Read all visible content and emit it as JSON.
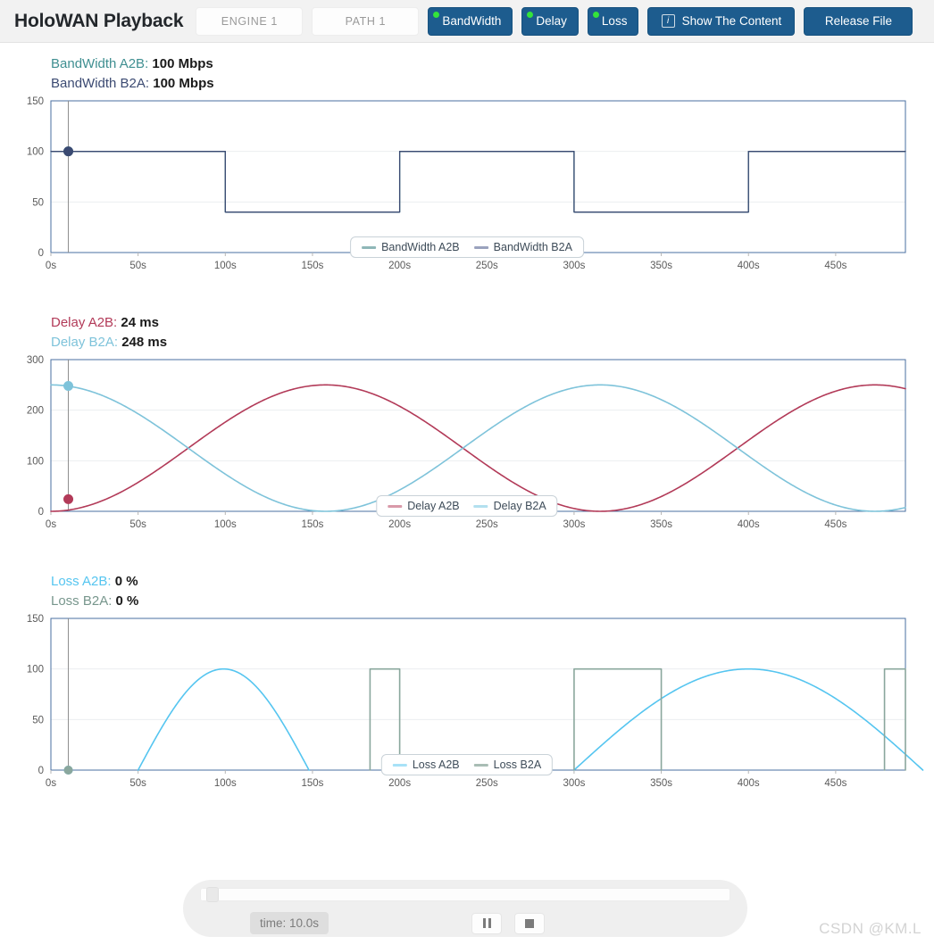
{
  "header": {
    "title": "HoloWAN Playback",
    "engine_label": "ENGINE 1",
    "path_label": "PATH 1",
    "bandwidth_btn": "BandWidth",
    "delay_btn": "Delay",
    "loss_btn": "Loss",
    "show_content_btn": "Show The Content",
    "show_content_icon": "info-icon",
    "release_file_btn": "Release File",
    "accent_blue": "#1d5c8e",
    "status_dot_color": "#34e33a"
  },
  "panels": {
    "bandwidth": {
      "a2b_label": "BandWidth A2B:",
      "a2b_value": "100 Mbps",
      "b2a_label": "BandWidth B2A:",
      "b2a_value": "100 Mbps",
      "a2b_color": "#3f8f91",
      "b2a_color": "#3b4a72",
      "legend": [
        "BandWidth A2B",
        "BandWidth B2A"
      ]
    },
    "delay": {
      "a2b_label": "Delay A2B:",
      "a2b_value": "24 ms",
      "b2a_label": "Delay B2A:",
      "b2a_value": "248 ms",
      "a2b_color": "#b23a58",
      "b2a_color": "#7ec3da",
      "legend": [
        "Delay A2B",
        "Delay B2A"
      ]
    },
    "loss": {
      "a2b_label": "Loss A2B:",
      "a2b_value": "0 %",
      "b2a_label": "Loss B2A:",
      "b2a_value": "0 %",
      "a2b_color": "#55c5f0",
      "b2a_color": "#8aa79d",
      "legend": [
        "Loss A2B",
        "Loss B2A"
      ]
    }
  },
  "player": {
    "time_label": "time: 10.0s",
    "pause_icon": "pause-icon",
    "stop_icon": "stop-icon",
    "progress_percent": 2
  },
  "watermark": "CSDN @KM.L",
  "chart_data": [
    {
      "type": "line",
      "id": "bandwidth",
      "title": "BandWidth",
      "xlabel": "",
      "ylabel": "Mbps",
      "xlim": [
        0,
        490
      ],
      "ylim": [
        0,
        150
      ],
      "yticks": [
        0,
        50,
        100,
        150
      ],
      "xticks": [
        0,
        50,
        100,
        150,
        200,
        250,
        300,
        350,
        400,
        450
      ],
      "xticklabels": [
        "0s",
        "50s",
        "100s",
        "150s",
        "200s",
        "250s",
        "300s",
        "350s",
        "400s",
        "450s"
      ],
      "grid": true,
      "legend_position": "bottom",
      "cursor_x": 10,
      "series": [
        {
          "name": "BandWidth A2B",
          "color": "#3f8f91",
          "style": "step",
          "points": [
            [
              0,
              100
            ],
            [
              100,
              100
            ],
            [
              100,
              40
            ],
            [
              200,
              40
            ],
            [
              200,
              100
            ],
            [
              300,
              100
            ],
            [
              300,
              40
            ],
            [
              400,
              40
            ],
            [
              400,
              100
            ],
            [
              490,
              100
            ]
          ],
          "marker": {
            "x": 10,
            "y": 100
          }
        },
        {
          "name": "BandWidth B2A",
          "color": "#3b4a72",
          "style": "step",
          "points": [
            [
              0,
              100
            ],
            [
              100,
              100
            ],
            [
              100,
              40
            ],
            [
              200,
              40
            ],
            [
              200,
              100
            ],
            [
              300,
              100
            ],
            [
              300,
              40
            ],
            [
              400,
              40
            ],
            [
              400,
              100
            ],
            [
              490,
              100
            ]
          ],
          "marker": {
            "x": 10,
            "y": 100
          }
        }
      ]
    },
    {
      "type": "line",
      "id": "delay",
      "title": "Delay",
      "xlabel": "",
      "ylabel": "ms",
      "xlim": [
        0,
        490
      ],
      "ylim": [
        0,
        300
      ],
      "yticks": [
        0,
        100,
        200,
        300
      ],
      "xticks": [
        0,
        50,
        100,
        150,
        200,
        250,
        300,
        350,
        400,
        450
      ],
      "xticklabels": [
        "0s",
        "50s",
        "100s",
        "150s",
        "200s",
        "250s",
        "300s",
        "350s",
        "400s",
        "450s"
      ],
      "grid": true,
      "legend_position": "bottom",
      "cursor_x": 10,
      "series": [
        {
          "name": "Delay A2B",
          "color": "#b23a58",
          "style": "sine",
          "amplitude": 125,
          "offset": 125,
          "period": 315,
          "phase": -90,
          "marker": {
            "x": 10,
            "y": 24
          }
        },
        {
          "name": "Delay B2A",
          "color": "#7ec3da",
          "style": "sine",
          "amplitude": 125,
          "offset": 125,
          "period": 315,
          "phase": 90,
          "marker": {
            "x": 10,
            "y": 248
          }
        }
      ]
    },
    {
      "type": "line",
      "id": "loss",
      "title": "Loss",
      "xlabel": "",
      "ylabel": "%",
      "xlim": [
        0,
        490
      ],
      "ylim": [
        0,
        150
      ],
      "yticks": [
        0,
        50,
        100,
        150
      ],
      "xticks": [
        0,
        50,
        100,
        150,
        200,
        250,
        300,
        350,
        400,
        450
      ],
      "xticklabels": [
        "0s",
        "50s",
        "100s",
        "150s",
        "200s",
        "250s",
        "300s",
        "350s",
        "400s",
        "450s"
      ],
      "grid": true,
      "legend_position": "bottom",
      "cursor_x": 10,
      "series": [
        {
          "name": "Loss A2B",
          "color": "#55c5f0",
          "style": "humps",
          "humps": [
            [
              50,
              148,
              100
            ],
            [
              300,
              500,
              100
            ]
          ],
          "marker": {
            "x": 10,
            "y": 0
          }
        },
        {
          "name": "Loss B2A",
          "color": "#8aa79d",
          "style": "pulses",
          "pulses": [
            [
              183,
              200,
              100
            ],
            [
              300,
              350,
              100
            ],
            [
              478,
              490,
              100
            ]
          ],
          "marker": {
            "x": 10,
            "y": 0
          }
        }
      ]
    }
  ]
}
